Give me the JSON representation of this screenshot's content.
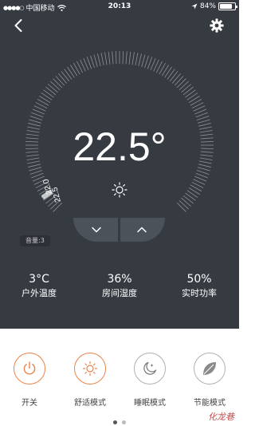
{
  "status_bar": {
    "carrier": "中国移动",
    "time": "20:13",
    "battery_text": "84%",
    "battery_level": 0.84
  },
  "nav": {
    "back_icon": "chevron-left-icon",
    "settings_icon": "gear-icon"
  },
  "dial": {
    "marker_set": "22.0",
    "marker_current": "22.5",
    "marker_fraction": 0.04,
    "temperature": "22.5°",
    "mode_icon": "sun-icon"
  },
  "controls": {
    "down_icon": "chevron-down-icon",
    "up_icon": "chevron-up-icon"
  },
  "volume_label": "音量:3",
  "stats": [
    {
      "value": "3°C",
      "label": "户外温度"
    },
    {
      "value": "36%",
      "label": "房间湿度"
    },
    {
      "value": "50%",
      "label": "实时功率"
    }
  ],
  "modes": [
    {
      "label": "开关",
      "icon": "power-icon"
    },
    {
      "label": "舒适模式",
      "icon": "sun-icon"
    },
    {
      "label": "睡眠模式",
      "icon": "moon-icon"
    },
    {
      "label": "节能模式",
      "icon": "leaf-icon"
    }
  ],
  "pager": {
    "current": 1,
    "total": 2
  },
  "watermark": "化龙巷",
  "colors": {
    "background": "#363b42",
    "accent": "#e8844a",
    "leaf_grey": "#8a8a8a"
  }
}
